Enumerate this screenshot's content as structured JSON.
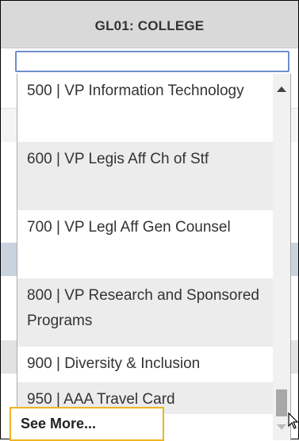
{
  "header": {
    "title": "GL01: COLLEGE"
  },
  "search": {
    "value": "",
    "placeholder": ""
  },
  "options": [
    {
      "code": "500",
      "label": "500 | VP Information Technology"
    },
    {
      "code": "600",
      "label": "600 | VP Legis Aff Ch of Stf"
    },
    {
      "code": "700",
      "label": "700 | VP Legl Aff Gen Counsel"
    },
    {
      "code": "800",
      "label": "800 | VP Research and Sponsored Programs"
    },
    {
      "code": "900",
      "label": "900 | Diversity & Inclusion"
    },
    {
      "code": "950",
      "label": "950 | AAA Travel Card"
    }
  ],
  "see_more": {
    "label": "See More..."
  },
  "colors": {
    "header_bg": "#d9d9d9",
    "input_border": "#6d8fce",
    "alt_row": "#ececec",
    "see_more_border": "#f0b323"
  },
  "icons": [
    "scroll-up-arrow-icon",
    "scroll-down-arrow-icon",
    "mouse-cursor-icon"
  ]
}
